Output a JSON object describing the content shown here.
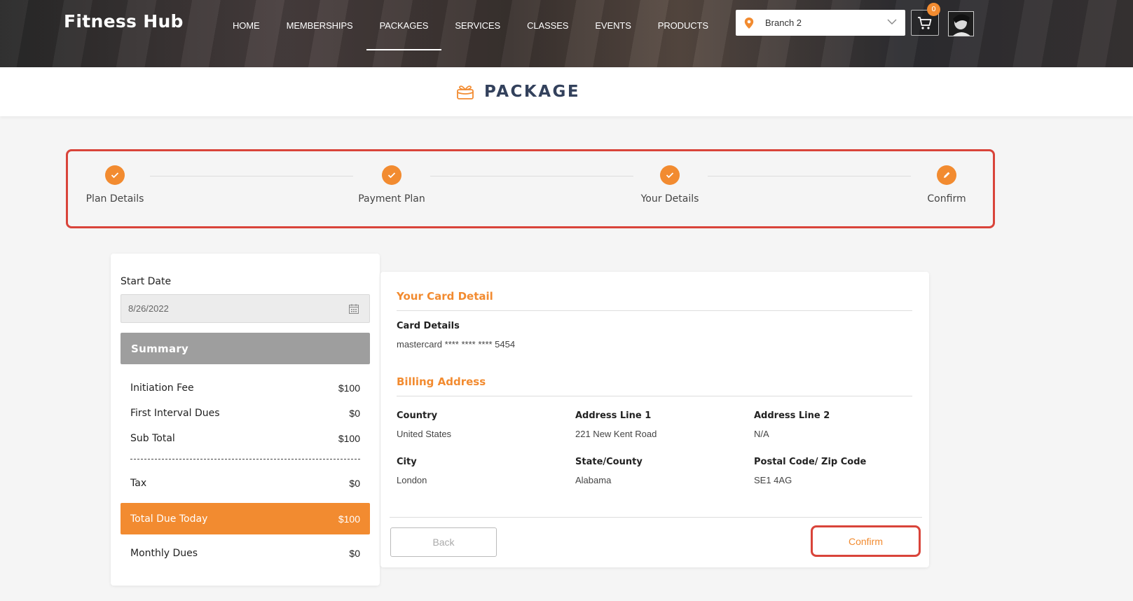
{
  "header": {
    "brand": "Fitness Hub",
    "nav": [
      {
        "label": "HOME",
        "active": false
      },
      {
        "label": "MEMBERSHIPS",
        "active": false
      },
      {
        "label": "PACKAGES",
        "active": true
      },
      {
        "label": "SERVICES",
        "active": false
      },
      {
        "label": "CLASSES",
        "active": false
      },
      {
        "label": "EVENTS",
        "active": false
      },
      {
        "label": "PRODUCTS",
        "active": false
      }
    ],
    "branch": {
      "selected": "Branch 2",
      "icon": "location-pin-icon"
    },
    "cart": {
      "count": "0",
      "icon": "cart-icon"
    }
  },
  "page": {
    "title": "PACKAGE",
    "icon": "gift-box-icon"
  },
  "stepper": {
    "steps": [
      {
        "label": "Plan Details",
        "state": "done"
      },
      {
        "label": "Payment Plan",
        "state": "done"
      },
      {
        "label": "Your Details",
        "state": "done"
      },
      {
        "label": "Confirm",
        "state": "current"
      }
    ]
  },
  "summary": {
    "start_date_label": "Start Date",
    "start_date_value": "8/26/2022",
    "heading": "Summary",
    "rows": [
      {
        "label": "Initiation Fee",
        "value": "$100"
      },
      {
        "label": "First Interval Dues",
        "value": "$0"
      },
      {
        "label": "Sub Total",
        "value": "$100"
      },
      {
        "label": "Tax",
        "value": "$0"
      }
    ],
    "total": {
      "label": "Total Due Today",
      "value": "$100"
    },
    "monthly": {
      "label": "Monthly Dues",
      "value": "$0"
    }
  },
  "card_detail": {
    "title": "Your Card Detail",
    "label": "Card Details",
    "value": "mastercard **** **** **** 5454"
  },
  "billing": {
    "title": "Billing Address",
    "fields": [
      {
        "label": "Country",
        "value": "United States"
      },
      {
        "label": "Address Line 1",
        "value": "221 New Kent Road"
      },
      {
        "label": "Address Line 2",
        "value": "N/A"
      },
      {
        "label": "City",
        "value": "London"
      },
      {
        "label": "State/County",
        "value": "Alabama"
      },
      {
        "label": "Postal Code/ Zip Code",
        "value": "SE1 4AG"
      }
    ]
  },
  "actions": {
    "back": "Back",
    "confirm": "Confirm"
  },
  "colors": {
    "accent": "#f28b30",
    "highlight": "#d9443a",
    "title": "#33415c"
  }
}
